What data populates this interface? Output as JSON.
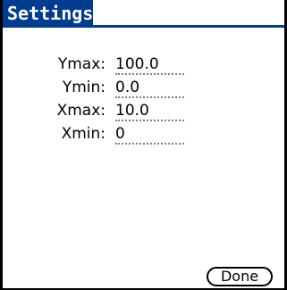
{
  "title": "Settings",
  "fields": [
    {
      "label": "Ymax:",
      "value": "100.0"
    },
    {
      "label": "Ymin:",
      "value": "0.0"
    },
    {
      "label": "Xmax:",
      "value": "10.0"
    },
    {
      "label": "Xmin:",
      "value": "0"
    }
  ],
  "done_label": "Done",
  "colors": {
    "title_bar": "#003d91",
    "title_text": "#ffffff",
    "field_underline": "#808080"
  }
}
